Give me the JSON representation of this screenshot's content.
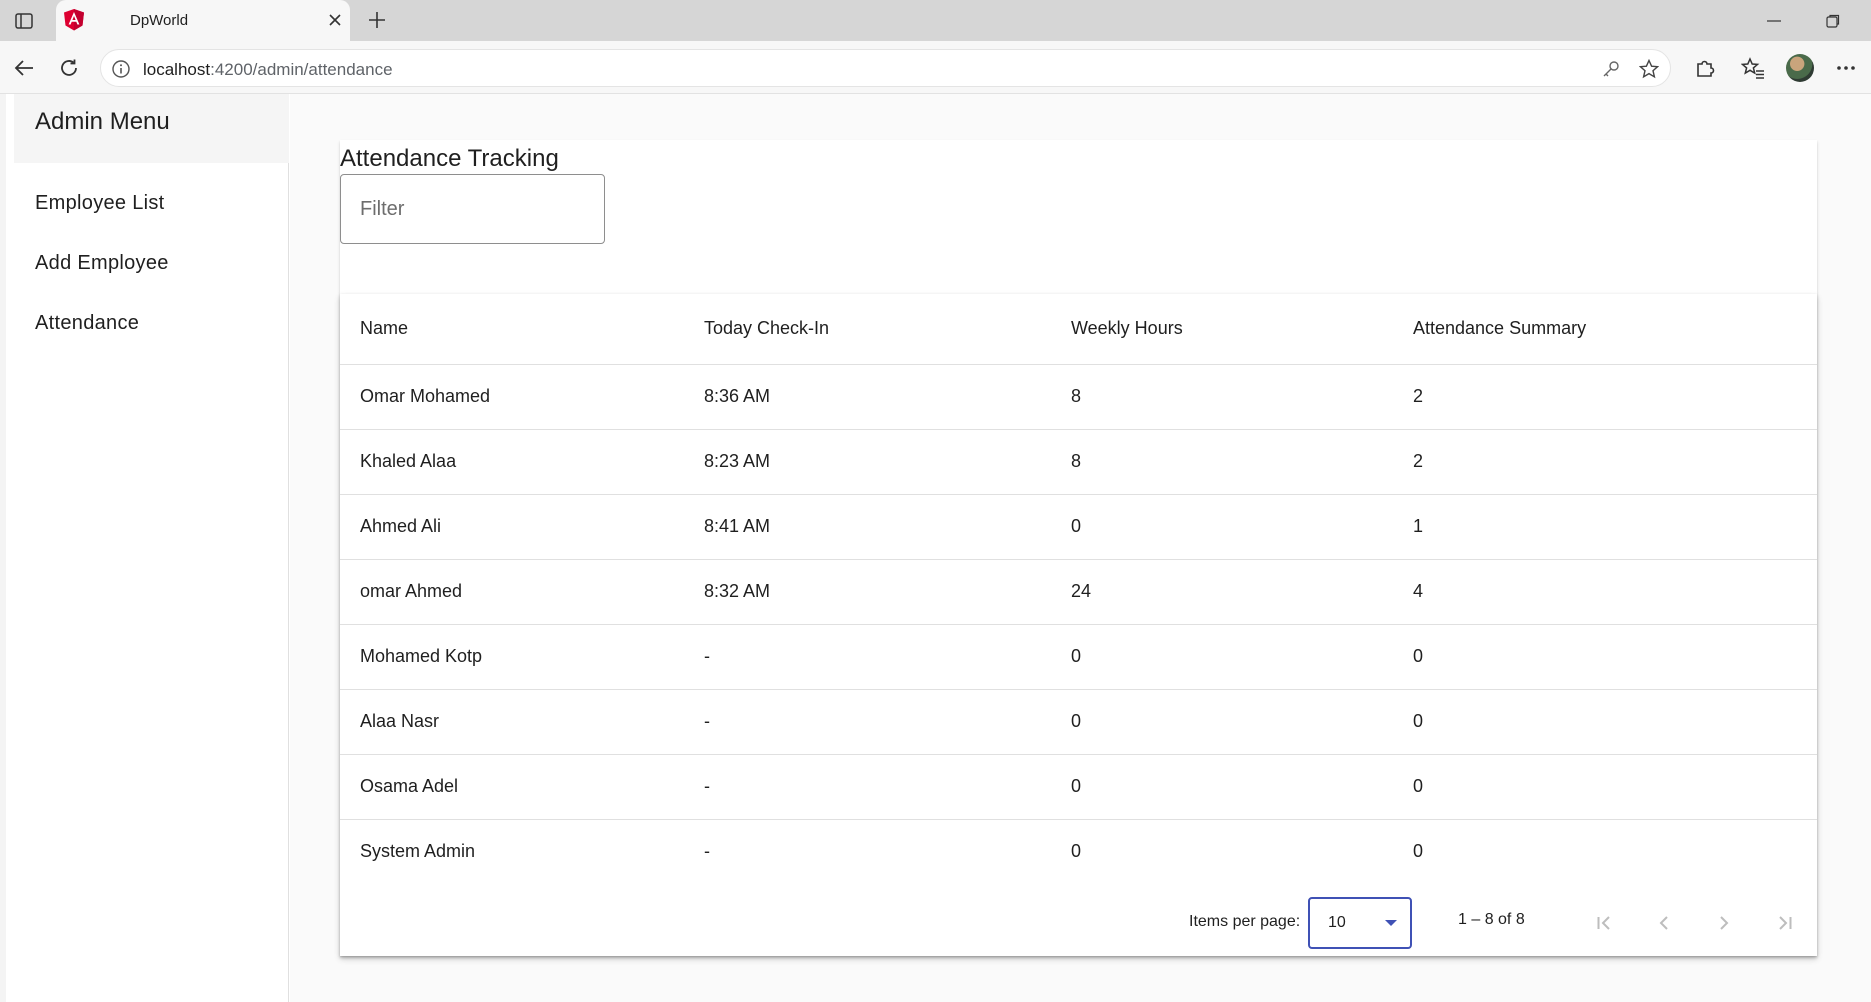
{
  "browser": {
    "tab_title": "DpWorld",
    "url_host": "localhost",
    "url_rest": ":4200/admin/attendance"
  },
  "sidebar": {
    "title": "Admin Menu",
    "items": [
      {
        "label": "Employee List"
      },
      {
        "label": "Add Employee"
      },
      {
        "label": "Attendance"
      }
    ]
  },
  "main": {
    "title": "Attendance Tracking",
    "filter_placeholder": "Filter",
    "filter_value": ""
  },
  "table": {
    "columns": [
      "Name",
      "Today Check-In",
      "Weekly Hours",
      "Attendance Summary"
    ],
    "rows": [
      [
        "Omar Mohamed",
        "8:36 AM",
        "8",
        "2"
      ],
      [
        "Khaled Alaa",
        "8:23 AM",
        "8",
        "2"
      ],
      [
        "Ahmed Ali",
        "8:41 AM",
        "0",
        "1"
      ],
      [
        "omar Ahmed",
        "8:32 AM",
        "24",
        "4"
      ],
      [
        "Mohamed Kotp",
        "-",
        "0",
        "0"
      ],
      [
        "Alaa Nasr",
        "-",
        "0",
        "0"
      ],
      [
        "Osama Adel",
        "-",
        "0",
        "0"
      ],
      [
        "System Admin",
        "-",
        "0",
        "0"
      ]
    ]
  },
  "paginator": {
    "items_per_page_label": "Items per page:",
    "page_size": "10",
    "range_label": "1 – 8 of 8"
  },
  "colors": {
    "accent": "#3f51b5",
    "angular_red": "#dd0031",
    "angular_pink": "#c3002f"
  },
  "icons": {
    "sidebar_toggle": "tab-sidebar-icon",
    "favicon": "angular-logo-icon",
    "close": "close-icon",
    "new_tab": "plus-icon",
    "back": "back-arrow-icon",
    "refresh": "refresh-icon",
    "site_info": "info-icon",
    "password": "key-icon",
    "favorite": "star-icon",
    "extensions": "puzzle-icon",
    "favorites": "favorites-icon",
    "more": "more-icon"
  }
}
